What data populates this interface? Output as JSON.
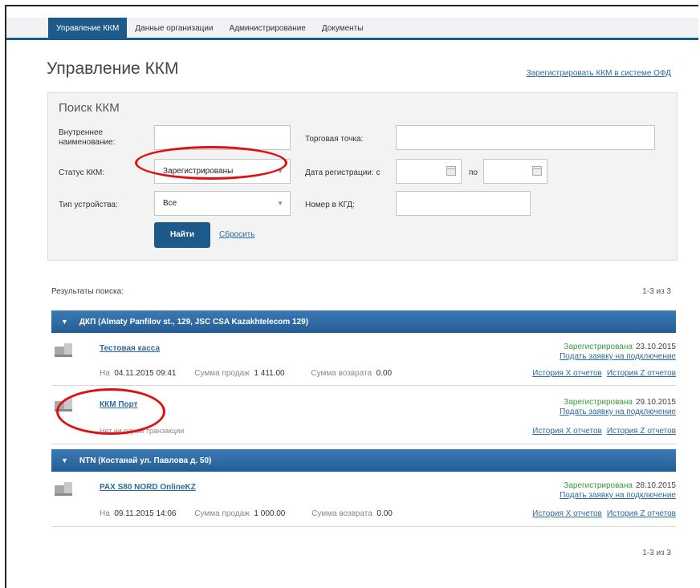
{
  "nav": {
    "tabs": [
      {
        "label": "Управление ККМ",
        "active": true
      },
      {
        "label": "Данные организации",
        "active": false
      },
      {
        "label": "Администрирование",
        "active": false
      },
      {
        "label": "Документы",
        "active": false
      }
    ]
  },
  "page": {
    "title": "Управление ККМ",
    "register_link": "Зарегистрировать ККМ в системе ОФД"
  },
  "search": {
    "title": "Поиск ККМ",
    "internal_name_label": "Внутреннее наименование:",
    "internal_name_value": "",
    "trade_point_label": "Торговая точка:",
    "trade_point_value": "",
    "status_label": "Статус ККМ:",
    "status_value": "Зарегистрированы",
    "reg_date_label": "Дата регистрации: с",
    "reg_date_to_label": "по",
    "device_type_label": "Тип устройства:",
    "device_type_value": "Все",
    "kgd_number_label": "Номер в КГД:",
    "kgd_number_value": "",
    "find_button": "Найти",
    "reset_link": "Сбросить"
  },
  "results": {
    "label": "Результаты поиска:",
    "pager_text": "1-3 из 3",
    "groups": [
      {
        "title": "ДКП (Almaty Panfilov st., 129, JSC CSA Kazakhtelecom 129)",
        "items": [
          {
            "name": "Тестовая касса",
            "status": "Зарегистрирована",
            "status_date": "23.10.2015",
            "apply_link": "Подать заявку на подключение",
            "on_label": "На",
            "on_datetime": "04.11.2015 09:41",
            "sales_label": "Сумма продаж",
            "sales_value": "1 411.00",
            "refund_label": "Сумма возврата",
            "refund_value": "0.00",
            "history_x": "История Х отчетов",
            "history_z": "История Z отчетов"
          },
          {
            "name": "ККМ Порт",
            "status": "Зарегистрирована",
            "status_date": "29.10.2015",
            "apply_link": "Подать заявку на подключение",
            "no_transactions": "Нет ни одной транзакции",
            "history_x": "История Х отчетов",
            "history_z": "История Z отчетов"
          }
        ]
      },
      {
        "title": "NTN (Костанай ул. Павлова д. 50)",
        "items": [
          {
            "name": "PAX S80 NORD OnlineKZ",
            "status": "Зарегистрирована",
            "status_date": "28.10.2015",
            "apply_link": "Подать заявку на подключение",
            "on_label": "На",
            "on_datetime": "09.11.2015 14:06",
            "sales_label": "Сумма продаж",
            "sales_value": "1 000.00",
            "refund_label": "Сумма возврата",
            "refund_value": "0.00",
            "history_x": "История Х отчетов",
            "history_z": "История Z отчетов"
          }
        ]
      }
    ]
  },
  "colors": {
    "primary": "#1d5a8a",
    "link": "#2c6aa0",
    "status_green": "#3a9a3a",
    "annotation_red": "#e01010"
  }
}
